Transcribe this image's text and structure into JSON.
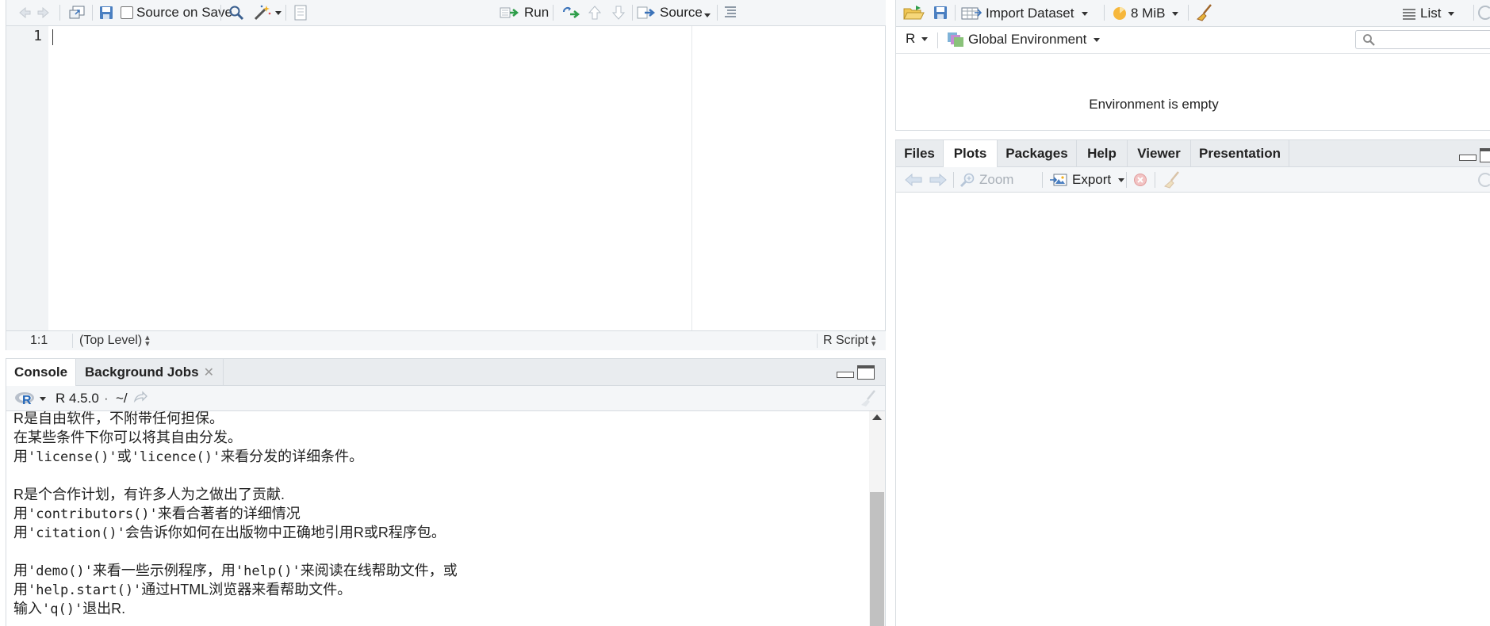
{
  "editor": {
    "toolbar": {
      "source_on_save_label": "Source on Save",
      "run_label": "Run",
      "source_label": "Source"
    },
    "line_number": "1",
    "status": {
      "position": "1:1",
      "scope": "(Top Level)",
      "file_type": "R Script"
    }
  },
  "console": {
    "tabs": [
      {
        "label": "Console",
        "active": true
      },
      {
        "label": "Background Jobs",
        "active": false
      }
    ],
    "r_version": "R 4.5.0",
    "path_sep": "·",
    "path": "~/",
    "lines": [
      [
        {
          "t": "R是自由软件，不附带任何担保。",
          "m": false
        }
      ],
      [
        {
          "t": "在某些条件下你可以将其自由分发。",
          "m": false
        }
      ],
      [
        {
          "t": "用",
          "m": false
        },
        {
          "t": "'license()'",
          "m": true
        },
        {
          "t": "或",
          "m": false
        },
        {
          "t": "'licence()'",
          "m": true
        },
        {
          "t": "来看分发的详细条件。",
          "m": false
        }
      ],
      [
        {
          "t": "",
          "m": false
        }
      ],
      [
        {
          "t": "R是个合作计划，有许多人为之做出了贡献.",
          "m": false
        }
      ],
      [
        {
          "t": "用",
          "m": false
        },
        {
          "t": "'contributors()'",
          "m": true
        },
        {
          "t": "来看合著者的详细情况",
          "m": false
        }
      ],
      [
        {
          "t": "用",
          "m": false
        },
        {
          "t": "'citation()'",
          "m": true
        },
        {
          "t": "会告诉你如何在出版物中正确地引用R或R程序包。",
          "m": false
        }
      ],
      [
        {
          "t": "",
          "m": false
        }
      ],
      [
        {
          "t": "用",
          "m": false
        },
        {
          "t": "'demo()'",
          "m": true
        },
        {
          "t": "来看一些示例程序，用",
          "m": false
        },
        {
          "t": "'help()'",
          "m": true
        },
        {
          "t": "来阅读在线帮助文件，或",
          "m": false
        }
      ],
      [
        {
          "t": "用",
          "m": false
        },
        {
          "t": "'help.start()'",
          "m": true
        },
        {
          "t": "通过HTML浏览器来看帮助文件。",
          "m": false
        }
      ],
      [
        {
          "t": "输入",
          "m": false
        },
        {
          "t": "'q()'",
          "m": true
        },
        {
          "t": "退出R.",
          "m": false
        }
      ]
    ]
  },
  "environment": {
    "toolbar": {
      "import_dataset_label": "Import Dataset",
      "memory_label": "8 MiB",
      "view_mode_label": "List"
    },
    "language_label": "R",
    "scope_label": "Global Environment",
    "search_placeholder": "",
    "empty_message": "Environment is empty"
  },
  "files_panel": {
    "tabs": [
      {
        "label": "Files",
        "active": false
      },
      {
        "label": "Plots",
        "active": true
      },
      {
        "label": "Packages",
        "active": false
      },
      {
        "label": "Help",
        "active": false
      },
      {
        "label": "Viewer",
        "active": false
      },
      {
        "label": "Presentation",
        "active": false
      }
    ],
    "toolbar": {
      "zoom_label": "Zoom",
      "export_label": "Export"
    }
  },
  "colors": {
    "pane_border": "#d6dbe0",
    "toolbar_bg": "#f4f6f8",
    "gutter_bg": "#f1f3f5",
    "accent_blue": "#3b73b9",
    "green_arrow": "#2e9e4a"
  }
}
